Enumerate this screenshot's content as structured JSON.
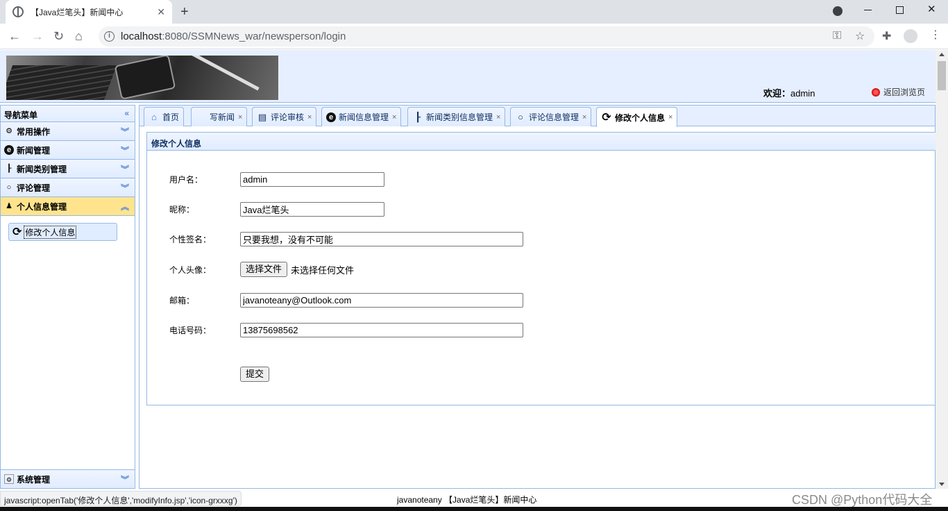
{
  "browser": {
    "tab_title": "【Java烂笔头】新闻中心",
    "tab_close": "✕",
    "new_tab": "+",
    "url_host": "localhost",
    "url_rest": ":8080/SSMNews_war/newsperson/login"
  },
  "header": {
    "welcome_label": "欢迎：",
    "username": "admin",
    "return_link": "返回浏览页"
  },
  "sidebar": {
    "title": "导航菜单",
    "sections": [
      {
        "label": "常用操作",
        "icon": "gear-icon"
      },
      {
        "label": "新闻管理",
        "icon": "circle-e-icon"
      },
      {
        "label": "新闻类别管理",
        "icon": "tree-icon"
      },
      {
        "label": "评论管理",
        "icon": "speech-bubble-icon"
      },
      {
        "label": "个人信息管理",
        "icon": "person-icon"
      }
    ],
    "active_item": "修改个人信息",
    "system": "系统管理"
  },
  "tabs": [
    {
      "label": "首页",
      "icon": "home-icon",
      "closable": false
    },
    {
      "label": "写新闻",
      "icon": "",
      "closable": true
    },
    {
      "label": "评论审核",
      "icon": "comment-review-icon",
      "closable": true
    },
    {
      "label": "新闻信息管理",
      "icon": "circle-e-icon",
      "closable": true
    },
    {
      "label": "新闻类别信息管理",
      "icon": "tree-icon",
      "closable": true
    },
    {
      "label": "评论信息管理",
      "icon": "speech-bubble-icon",
      "closable": true
    },
    {
      "label": "修改个人信息",
      "icon": "refresh-icon",
      "closable": true,
      "active": true
    }
  ],
  "form": {
    "title": "修改个人信息",
    "username_label": "用户名：",
    "username_value": "admin",
    "nickname_label": "昵称：",
    "nickname_value": "Java烂笔头",
    "signature_label": "个性签名：",
    "signature_value": "只要我想，没有不可能",
    "avatar_label": "个人头像：",
    "file_button": "选择文件",
    "file_status": "未选择任何文件",
    "email_label": "邮箱：",
    "email_value": "javanoteany@Outlook.com",
    "phone_label": "电话号码：",
    "phone_value": "13875698562",
    "submit": "提交"
  },
  "status": {
    "link_preview": "javascript:openTab('修改个人信息','modifyInfo.jsp','icon-grxxxg')",
    "footer": "javanoteany 【Java烂笔头】新闻中心",
    "watermark": "CSDN @Python代码大全"
  }
}
